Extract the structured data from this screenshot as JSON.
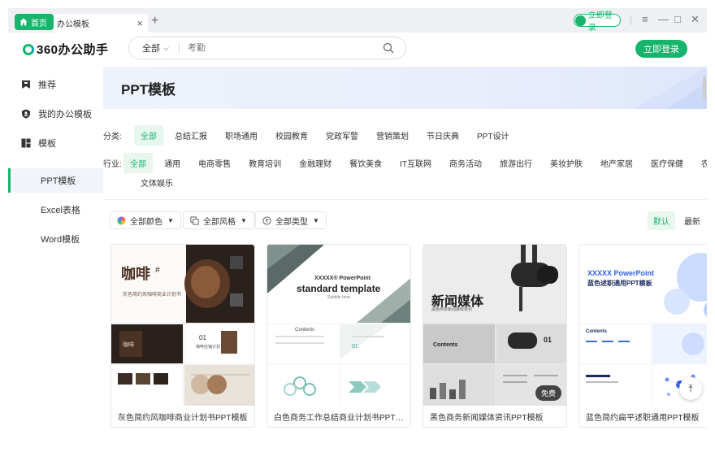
{
  "tabs": {
    "home_label": "首页",
    "active_label": "办公模板",
    "close_glyph": "×",
    "add_glyph": "+"
  },
  "titlebar": {
    "login_chip": "立即登录",
    "menu_glyph": "≡",
    "min_glyph": "—",
    "max_glyph": "□",
    "close_glyph": "✕"
  },
  "header": {
    "logo_text": "360办公助手",
    "search_scope": "全部",
    "search_placeholder": "考勤",
    "login_button": "立即登录"
  },
  "sidebar": {
    "items": [
      {
        "label": "推荐",
        "icon": "bookmark-icon"
      },
      {
        "label": "我的办公模板",
        "icon": "user-shield-icon"
      },
      {
        "label": "模板",
        "icon": "grid-icon"
      }
    ],
    "subitems": [
      {
        "label": "PPT模板",
        "active": true
      },
      {
        "label": "Excel表格",
        "active": false
      },
      {
        "label": "Word模板",
        "active": false
      }
    ]
  },
  "main": {
    "title": "PPT模板",
    "category_label": "分类:",
    "categories": [
      "全部",
      "总结汇报",
      "职场通用",
      "校园教育",
      "党政军警",
      "营销策划",
      "节日庆典",
      "PPT设计"
    ],
    "industry_label": "行业:",
    "industries_row1": [
      "全部",
      "通用",
      "电商零售",
      "教育培训",
      "金融理财",
      "餐饮美食",
      "IT互联网",
      "商务活动",
      "旅游出行",
      "美妆护肤",
      "地产家居",
      "医疗保健",
      "农"
    ],
    "industries_row2": [
      "文体娱乐"
    ],
    "filters": {
      "color": "全部颜色",
      "style": "全部风格",
      "type": "全部类型"
    },
    "sort": [
      "默认",
      "最新"
    ],
    "free_badge": "免费",
    "back_top_glyph": "⌃"
  },
  "cards": [
    {
      "caption": "灰色简约风咖啡商业计划书PPT模板",
      "thumb_title": "咖啡",
      "thumb_hash": "#",
      "thumb_sub": "灰色简约风咖啡商业计划书",
      "thumb_num": "01",
      "thumb_small": "咖啡店铺计划",
      "thumb_tag": "咖啡"
    },
    {
      "caption": "白色商务工作总结商业计划书PPT案...",
      "thumb_title": "XXXXX® PowerPoint",
      "thumb_title2": "standard template",
      "thumb_sub": "Subtitle here",
      "thumb_contents": "Contents",
      "thumb_num": "01"
    },
    {
      "caption": "黑色商务新闻媒体资讯PPT模板",
      "thumb_title": "新闻媒体",
      "thumb_sub": "黑色商务新闻媒体资讯",
      "thumb_contents": "Contents",
      "thumb_num": "01"
    },
    {
      "caption": "蓝色简约扁平述职通用PPT模板",
      "thumb_title": "XXXXX PowerPoint",
      "thumb_title2": "蓝色述职通用PPT模板",
      "thumb_contents": "Contents"
    }
  ],
  "colors": {
    "brand": "#17b46b",
    "brand_light": "#e7f7ee",
    "banner": "#eef2fb"
  }
}
